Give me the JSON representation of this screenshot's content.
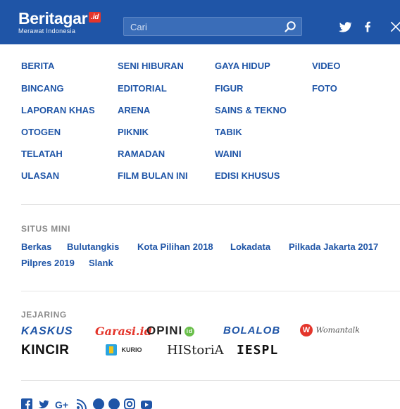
{
  "header": {
    "logo_text": "Beritagar",
    "logo_badge": ".id",
    "logo_tagline": "Merawat Indonesia",
    "search_placeholder": "Cari",
    "icons": [
      "search-icon",
      "twitter-icon",
      "facebook-icon",
      "close-icon"
    ],
    "bg_color": "#1f55a7"
  },
  "nav": {
    "columns": [
      [
        "BERITA",
        "BINCANG",
        "LAPORAN KHAS",
        "OTOGEN",
        "TELATAH",
        "ULASAN"
      ],
      [
        "SENI HIBURAN",
        "EDITORIAL",
        "ARENA",
        "PIKNIK",
        "RAMADAN",
        "FILM BULAN INI"
      ],
      [
        "GAYA HIDUP",
        "FIGUR",
        "SAINS & TEKNO",
        "TABIK",
        "WAINI",
        "EDISI KHUSUS"
      ],
      [
        "VIDEO",
        "FOTO"
      ]
    ]
  },
  "situs_mini": {
    "title": "SITUS MINI",
    "links": [
      "Berkas",
      "Bulutangkis",
      "Kota Pilihan 2018",
      "Lokadata",
      "Pilkada Jakarta 2017",
      "Pilpres 2019",
      "Slank"
    ]
  },
  "jejaring": {
    "title": "JEJARING",
    "brands": [
      "KASKUS",
      "Garasi.id",
      "OPINI",
      "id",
      "BOLALOB",
      "W",
      "Womantalk",
      "KINCIR",
      "KURIO",
      "HIStoriA",
      "IESPL"
    ]
  },
  "social": {
    "icons": [
      "facebook-icon",
      "twitter-icon",
      "google-plus-icon",
      "rss-icon",
      "line-icon",
      "flipboard-icon",
      "instagram-icon",
      "youtube-icon"
    ]
  },
  "colors": {
    "link": "#1f55a7",
    "muted": "#8a8a8a",
    "accent": "#e4352b"
  }
}
